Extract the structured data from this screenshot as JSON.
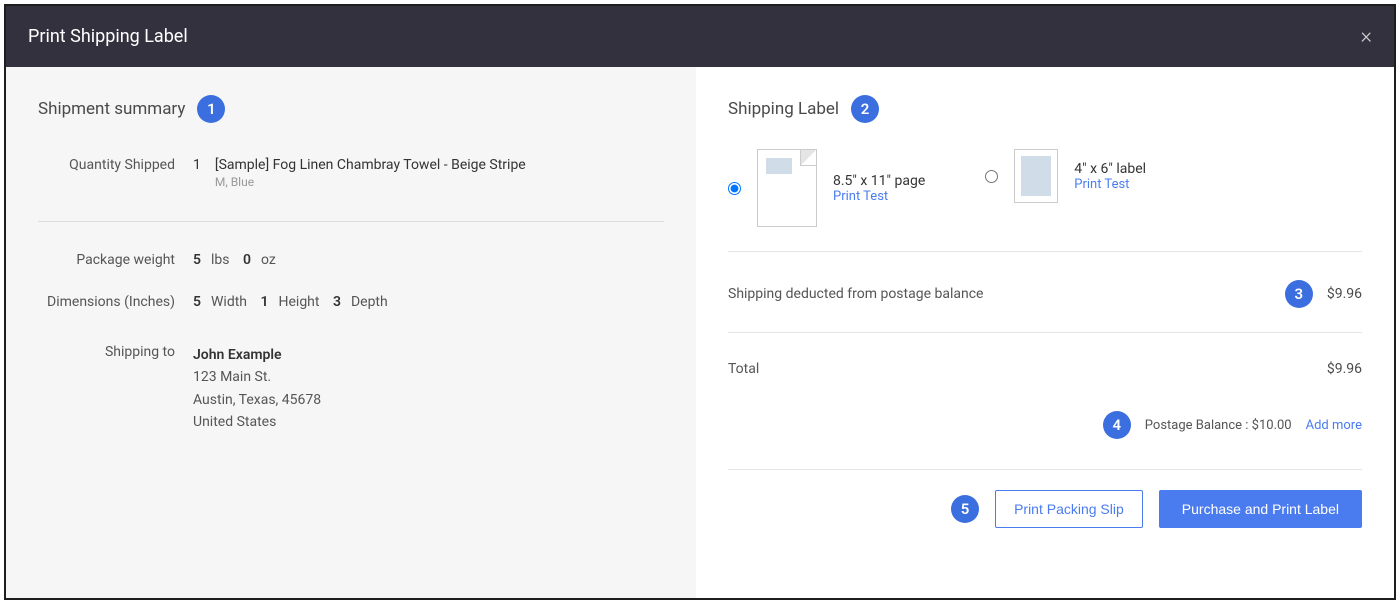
{
  "modal": {
    "title": "Print Shipping Label"
  },
  "summary": {
    "heading": "Shipment summary",
    "qty_label": "Quantity Shipped",
    "item": {
      "qty": "1",
      "name": "[Sample] Fog Linen Chambray Towel - Beige Stripe",
      "variant": "M, Blue"
    },
    "weight_label": "Package weight",
    "weight_lbs": "5",
    "weight_lbs_unit": "lbs",
    "weight_oz": "0",
    "weight_oz_unit": "oz",
    "dim_label": "Dimensions (Inches)",
    "dim_w": "5",
    "dim_w_label": "Width",
    "dim_h": "1",
    "dim_h_label": "Height",
    "dim_d": "3",
    "dim_d_label": "Depth",
    "shipto_label": "Shipping to",
    "address": {
      "name": "John Example",
      "line1": "123 Main St.",
      "line2": "Austin, Texas, 45678",
      "country": "United States"
    }
  },
  "label": {
    "heading": "Shipping Label",
    "opt_page": "8.5\" x 11\" page",
    "opt_label": "4\" x 6\" label",
    "print_test": "Print Test",
    "deducted_text": "Shipping deducted from postage balance",
    "deducted_amount": "$9.96",
    "total_label": "Total",
    "total_amount": "$9.96",
    "balance_text": "Postage Balance : $10.00",
    "add_more": "Add more"
  },
  "actions": {
    "packing_slip": "Print Packing Slip",
    "purchase": "Purchase and Print Label"
  },
  "callouts": {
    "c1": "1",
    "c2": "2",
    "c3": "3",
    "c4": "4",
    "c5": "5"
  }
}
